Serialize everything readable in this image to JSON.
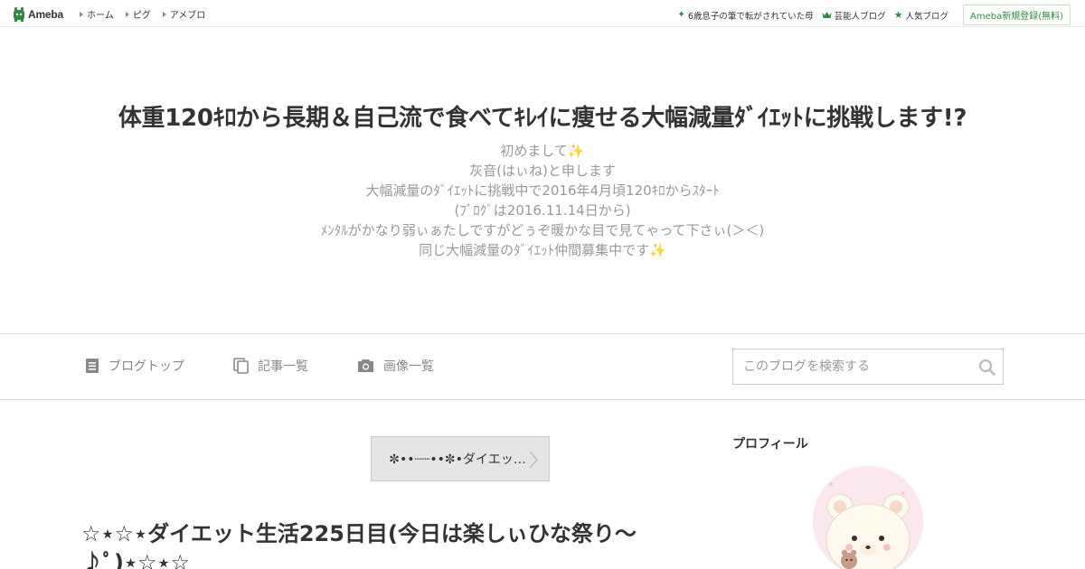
{
  "topbar": {
    "logo_text": "Ameba",
    "nav": [
      "ホーム",
      "ピグ",
      "アメブロ"
    ],
    "right_links": [
      {
        "icon": "sparkle-icon",
        "label": "6歳息子の筆で転がされていた母"
      },
      {
        "icon": "crown-icon",
        "label": "芸能人ブログ"
      },
      {
        "icon": "star-icon",
        "label": "人気ブログ"
      }
    ],
    "register_label": "Ameba新規登録(無料)",
    "accent_color": "#2d8c3c"
  },
  "header": {
    "title": "体重120ｷﾛから長期＆自己流で食べてｷﾚｲに痩せる大幅減量ﾀﾞｲｴｯﾄに挑戦します!?",
    "description": [
      "初めまして✨",
      "灰音(はぃね)と申します",
      "大幅減量のﾀﾞｲｴｯﾄに挑戦中で2016年4月頃120ｷﾛからｽﾀｰﾄ",
      "(ﾌﾞﾛｸﾞは2016.11.14日から)",
      "ﾒﾝﾀﾙがかなり弱ぃぁたしですがどぅぞ暖かな目で見てゃって下さぃ(＞＜)",
      "同じ大幅減量のﾀﾞｲｴｯﾄ仲間募集中です✨"
    ]
  },
  "nav": {
    "blog_top": "ブログトップ",
    "entry_list": "記事一覧",
    "image_list": "画像一覧",
    "search_placeholder": "このブログを検索する"
  },
  "main": {
    "theme_label": "✼••┈┈••✼•ダイエッ…",
    "entry_title": "☆⋆☆⋆ダイエット生活225日目(今日は楽しぃひな祭り〜♪ﾟ)⋆☆⋆☆"
  },
  "sidebar": {
    "profile_heading": "プロフィール"
  }
}
